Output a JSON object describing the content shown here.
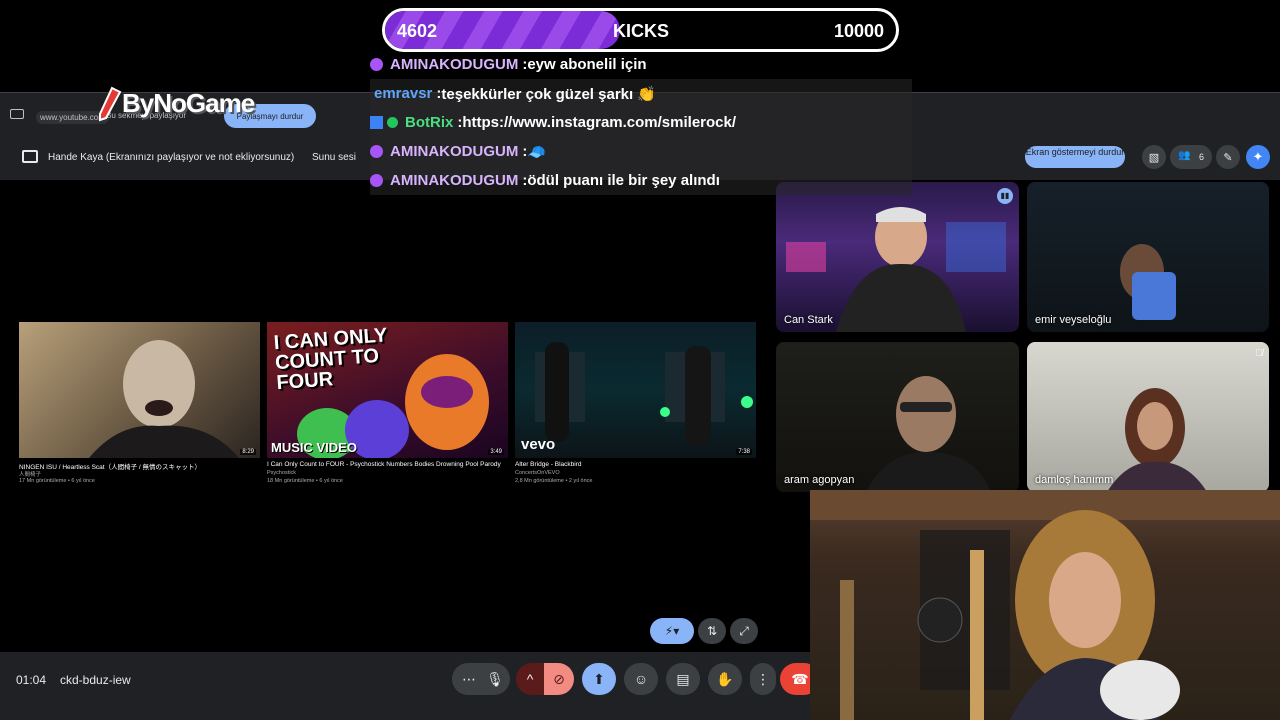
{
  "kicks": {
    "current": "4602",
    "label": "KICKS",
    "goal": "10000",
    "progress": 0.46
  },
  "logo": {
    "text": "ByNoGame"
  },
  "browser": {
    "url": "www.youtube.com",
    "share_note": "Bu sekmeyi paylaşıyor",
    "stop_share": "Paylaşmayı durdur"
  },
  "meet_bar": {
    "presenting": "Hande Kaya (Ekranınızı paylaşıyor ve not ekliyorsunuz)",
    "presentation_sound": "Sunu sesi",
    "stop_showing": "Ekran göstermeyi durdur",
    "people_count": "6"
  },
  "chat": [
    {
      "user": "AMINAKODUGUM",
      "sep": " : ",
      "message": "eyw abonelil için",
      "user_color": "#d8b4fe",
      "badge_color": "#a855f7"
    },
    {
      "user": "emravsr",
      "sep": " : ",
      "message": "teşekkürler çok güzel şarkı 👏",
      "user_color": "#60a5fa",
      "badge_color": ""
    },
    {
      "user": "BotRix",
      "sep": " : ",
      "message": "https://www.instagram.com/smilerock/",
      "user_color": "#4ade80",
      "badge_color": "#3b82f6"
    },
    {
      "user": "AMINAKODUGUM",
      "sep": " : ",
      "message": "🧢",
      "user_color": "#d8b4fe",
      "badge_color": "#a855f7"
    },
    {
      "user": "AMINAKODUGUM",
      "sep": " : ",
      "message": "ödül puanı ile bir şey alındı",
      "user_color": "#d8b4fe",
      "badge_color": "#a855f7"
    }
  ],
  "videos": [
    {
      "title": "NINGEN ISU / Heartless Scat（人間椅子 / 無情のスキャット）",
      "channel": "人間椅子",
      "meta": "17 Mn görüntüleme • 6 yıl önce",
      "duration": "8:29",
      "overlay": ""
    },
    {
      "title": "I Can Only Count to FOUR - Psychostick Numbers Bodies Drowning Pool Parody",
      "channel": "Psychostick",
      "meta": "18 Mn görüntüleme • 6 yıl önce",
      "duration": "3:49",
      "overlay": "I CAN ONLY COUNT TO FOUR",
      "overlay2": "MUSIC VIDEO"
    },
    {
      "title": "Alter Bridge - Blackbird",
      "channel": "ConcertsOnVEVO",
      "meta": "2,8 Mn görüntüleme • 2 yıl önce",
      "duration": "7:38",
      "overlay": "vevo"
    }
  ],
  "participants": [
    {
      "name": "Can Stark"
    },
    {
      "name": "emir veyseloğlu"
    },
    {
      "name": "aram agopyan"
    },
    {
      "name": "damloş hanımm"
    }
  ],
  "bottom": {
    "time": "01:04",
    "meeting_code": "ckd-bduz-iew"
  },
  "icons": {
    "more": "⋯",
    "mic": "🎙",
    "chevron": "^",
    "cam_off": "⊘",
    "present": "⬆",
    "emoji": "☺",
    "captions": "▤",
    "hand": "✋",
    "options": "⋮",
    "end_call": "☎",
    "lock": "🔒"
  },
  "colors": {
    "accent": "#8ab4f8",
    "end_call": "#ea4335",
    "kicks_fill": "#8b3ee0"
  }
}
